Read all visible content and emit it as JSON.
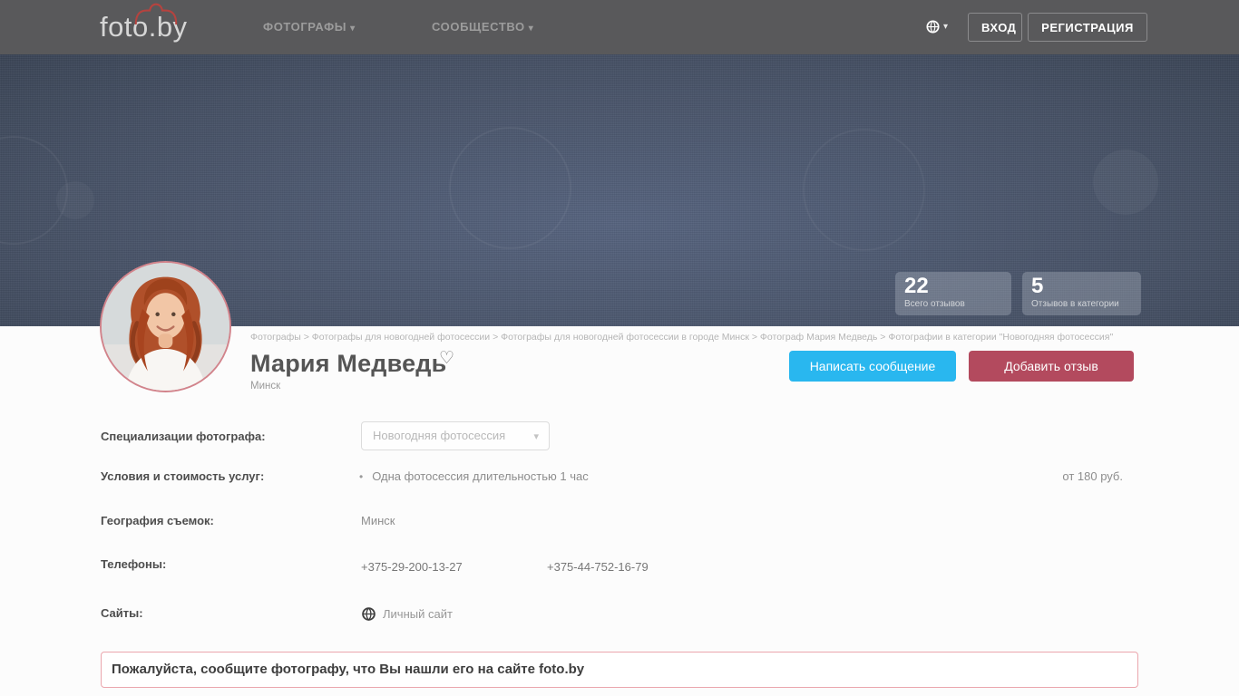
{
  "navbar": {
    "logo": "foto.by",
    "menu": [
      {
        "label": "ФОТОГРАФЫ"
      },
      {
        "label": "СООБЩЕСТВО"
      }
    ],
    "login_label": "ВХОД",
    "register_label": "РЕГИСТРАЦИЯ"
  },
  "hero": {
    "stats": [
      {
        "value": "22",
        "label": "Всего отзывов"
      },
      {
        "value": "5",
        "label": "Отзывов в категории"
      }
    ]
  },
  "profile": {
    "breadcrumb": "Фотографы > Фотографы для новогодней фотосессии > Фотографы для новогодней фотосессии в городе Минск > Фотограф Мария Медведь > Фотографии в категории \"Новогодняя фотосессия\"",
    "name": "Мария Медведь",
    "city": "Минск",
    "message_button_label": "Написать сообщение",
    "review_button_label": "Добавить отзыв"
  },
  "details": {
    "specializations_label": "Специализации фотографа:",
    "specializations_value": "Новогодняя фотосессия",
    "pricing_label": "Условия и стоимость услуг:",
    "pricing_item": "Одна фотосессия длительностью 1 час",
    "pricing_price": "от 180 руб.",
    "geography_label": "География съемок:",
    "geography_value": "Минск",
    "phones_label": "Телефоны:",
    "phone_1": "+375-29-200-13-27",
    "phone_2": "+375-44-752-16-79",
    "sites_label": "Сайты:",
    "site_link_label": "Личный сайт"
  },
  "notice": {
    "text": "Пожалуйста, сообщите фотографу, что Вы нашли его на сайте foto.by"
  },
  "icons": {
    "caret_down": "▾",
    "heart": "♡",
    "bullet": "•"
  },
  "colors": {
    "accent_blue": "#29b7ef",
    "accent_red": "#b34a5e",
    "navbar_bg": "#59595b",
    "hero_dark": "#2a3140"
  }
}
